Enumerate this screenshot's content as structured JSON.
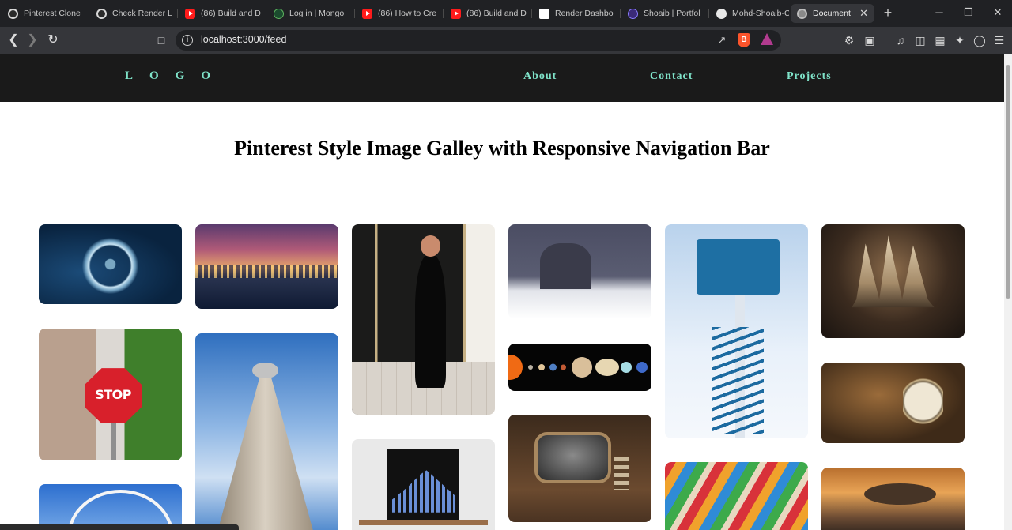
{
  "browser": {
    "tabs": [
      {
        "title": "Pinterest Clone",
        "favicon": "openai-icon"
      },
      {
        "title": "Check Render L",
        "favicon": "openai-icon"
      },
      {
        "title": "(86) Build and D",
        "favicon": "youtube-icon"
      },
      {
        "title": "Log in | Mongo",
        "favicon": "mongodb-icon"
      },
      {
        "title": "(86) How to Cre",
        "favicon": "youtube-icon"
      },
      {
        "title": "(86) Build and D",
        "favicon": "youtube-icon"
      },
      {
        "title": "Render Dashbo",
        "favicon": "render-icon"
      },
      {
        "title": "Shoaib | Portfol",
        "favicon": "portfolio-icon"
      },
      {
        "title": "Mohd-Shoaib-C",
        "favicon": "github-icon"
      },
      {
        "title": "Document",
        "favicon": "globe-icon",
        "active": true
      }
    ],
    "new_tab": "+",
    "address": "localhost:3000/feed",
    "colors": {
      "tabstrip": "#202124",
      "toolbar": "#35363a",
      "omnibox": "#202124"
    }
  },
  "site": {
    "logo": "LOGO",
    "nav": [
      "About",
      "Contact",
      "Projects"
    ],
    "title": "Pinterest Style Image Galley with Responsive Navigation Bar",
    "colors": {
      "nav_bg": "#1a1a1a",
      "nav_text": "#7fe3c9"
    }
  },
  "gallery": {
    "columns": [
      [
        "swirl-image",
        "stop-sign-image",
        "ferris-wheel-image"
      ],
      [
        "prague-night-image",
        "cn-tower-image"
      ],
      [
        "woman-portrait-image",
        "chart-board-image"
      ],
      [
        "snowy-cathedral-image",
        "solar-system-image",
        "retro-tv-image"
      ],
      [
        "blue-tower-image",
        "colored-pencils-image"
      ],
      [
        "sailing-ship-image",
        "pocket-clock-image",
        "scifi-city-image"
      ]
    ],
    "stop_sign_text": "STOP"
  }
}
